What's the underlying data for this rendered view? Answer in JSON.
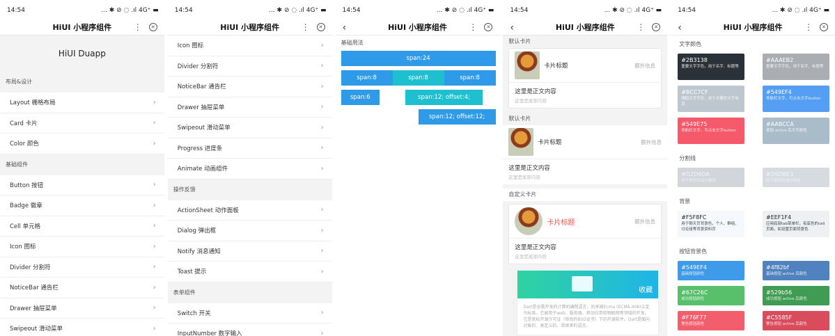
{
  "status": {
    "time": "14:54",
    "icons": "... ✱ ⊘ ◌ .ıl 4G⁺ ▬"
  },
  "nav": {
    "title": "HiUI 小程序组件",
    "menu_icon": "more-dots-icon",
    "close_icon": "close-circle-icon",
    "back_glyph": "‹"
  },
  "screen1": {
    "app_title": "HiUI Duapp",
    "sections": [
      {
        "title": "布局&设计",
        "items": [
          "Layout 栅格布局",
          "Card 卡片",
          "Color 颜色"
        ]
      },
      {
        "title": "基础组件",
        "items": [
          "Button 按钮",
          "Badge 徽章",
          "Cell 单元格",
          "Icon 图标",
          "Divider 分割符",
          "NoticeBar 通告栏",
          "Drawer 抽屉菜单",
          "Swipeout 滑动菜单"
        ]
      }
    ]
  },
  "screen2": {
    "items_top": [
      "Icon 图标",
      "Divider 分割符",
      "NoticeBar 通告栏",
      "Drawer 抽屉菜单",
      "Swipeout 滑动菜单",
      "Progress 进度条",
      "Animate 动画组件"
    ],
    "section2": "操作反馈",
    "items_mid": [
      "ActionSheet 动作面板",
      "Dialog 弹出框",
      "Notify 消息通知",
      "Toast 提示"
    ],
    "section3": "表单组件",
    "items_bottom": [
      "Switch 开关",
      "InputNumber 数字输入"
    ]
  },
  "screen3": {
    "label": "基础用法",
    "rows": [
      [
        {
          "text": "span:24",
          "span": 24,
          "offset": 0,
          "color": "#2f9ae8"
        }
      ],
      [
        {
          "text": "span:8",
          "span": 8,
          "offset": 0,
          "color": "#2f9ae8"
        },
        {
          "text": "span:8",
          "span": 8,
          "offset": 0,
          "color": "#1ebfcf"
        },
        {
          "text": "span:8",
          "span": 8,
          "offset": 0,
          "color": "#2f9ae8"
        }
      ],
      [
        {
          "text": "span:6",
          "span": 6,
          "offset": 0,
          "color": "#2f9ae8"
        },
        {
          "text": "span:12; offset:4;",
          "span": 12,
          "offset": 4,
          "color": "#1ebfcf"
        }
      ],
      [
        {
          "text": "span:12; offset:12;",
          "span": 12,
          "offset": 12,
          "color": "#2f9ae8"
        }
      ]
    ]
  },
  "screen4": {
    "cards": [
      {
        "label": "默认卡片",
        "title": "卡片标题",
        "extra": "额外信息",
        "body": "这里是正文内容",
        "footer": "这里是尾部内容"
      },
      {
        "label": "默认卡片",
        "title": "卡片标题",
        "extra": "额外信息",
        "body": "这里是正文内容",
        "footer": "这里是尾部内容"
      },
      {
        "label": "自定义卡片",
        "title": "卡片标题",
        "extra": "额外信息",
        "body": "这里是正文内容",
        "footer": "这里是尾部内容"
      }
    ],
    "banner_label": "收藏",
    "banner_text": "Dart是谷歌开发的计算机编程语言，后来被Ecma (ECMA-408)认定为标准。它被用于web、服务器、移动应用和物联网等领域的开发。它是宽松开源许可证（修改的BSD证书）下的开源软件。Dart是面向对象的、类定义的、单继承的语言。"
  },
  "screen5": {
    "groups": [
      {
        "title": "文字颜色",
        "swatches": [
          {
            "hex": "#2B3138",
            "desc": "重要文字字色，用于名字、标题等",
            "bg": "#2b3138",
            "fg": "#ffffff"
          },
          {
            "hex": "#AAAEB2",
            "desc": "重要文字字色，用于名字、标题等",
            "bg": "#aaaeb2",
            "fg": "#ffffff"
          },
          {
            "hex": "#BCC7CF",
            "desc": "辅助文字字色，用于次要的文字信息",
            "bg": "#bcc7cf",
            "fg": "#ffffff"
          },
          {
            "hex": "#549EF4",
            "desc": "导航栏文字，可点击文字button",
            "bg": "#549ef4",
            "fg": "#ffffff"
          },
          {
            "hex": "#549E75",
            "desc": "导航栏文字，可点击文字button",
            "bg": "#f5596a",
            "fg": "#ffffff"
          },
          {
            "hex": "#AABCCA",
            "desc": "按钮 active 后文字颜色",
            "bg": "#aabcca",
            "fg": "#ffffff"
          }
        ]
      },
      {
        "title": "分割线",
        "swatches": [
          {
            "hex": "#D2D6DA",
            "desc": "用于颜色较深分割线",
            "bg": "#d2d6da",
            "fg": "#f4f5f6"
          },
          {
            "hex": "#D6DBE1",
            "desc": "用于颜色较浅分割线",
            "bg": "#d6dbe1",
            "fg": "#f4f5f6"
          }
        ]
      },
      {
        "title": "背景",
        "swatches": [
          {
            "hex": "#F5F8FC",
            "desc": "用于聊天页背景色，个人、群组、讨论组等背景资料页",
            "bg": "#f5f8fc",
            "fg": "#222222"
          },
          {
            "hex": "#EEF1F4",
            "desc": "应用底部tab菜单栏，有底色的cell页面，如设置页面背景色",
            "bg": "#eef1f4",
            "fg": "#222222"
          }
        ]
      },
      {
        "title": "按钮背景色",
        "swatches": [
          {
            "hex": "#549EF4",
            "desc": "基础按钮颜色",
            "bg": "#3d9be9",
            "fg": "#ffffff"
          },
          {
            "hex": "#4f82bf",
            "desc": "基础按钮 active 后颜色",
            "bg": "#4f82bf",
            "fg": "#ffffff"
          },
          {
            "hex": "#67C26C",
            "desc": "成功按钮颜色",
            "bg": "#58c06b",
            "fg": "#ffffff"
          },
          {
            "hex": "#529b56",
            "desc": "成功按钮 active 后颜色",
            "bg": "#3f9c52",
            "fg": "#ffffff"
          },
          {
            "hex": "#F76F77",
            "desc": "警告按钮颜色",
            "bg": "#f35e6c",
            "fg": "#ffffff"
          },
          {
            "hex": "#C5585F",
            "desc": "警告按钮 active 后颜色",
            "bg": "#d84c5c",
            "fg": "#ffffff"
          }
        ]
      }
    ]
  }
}
